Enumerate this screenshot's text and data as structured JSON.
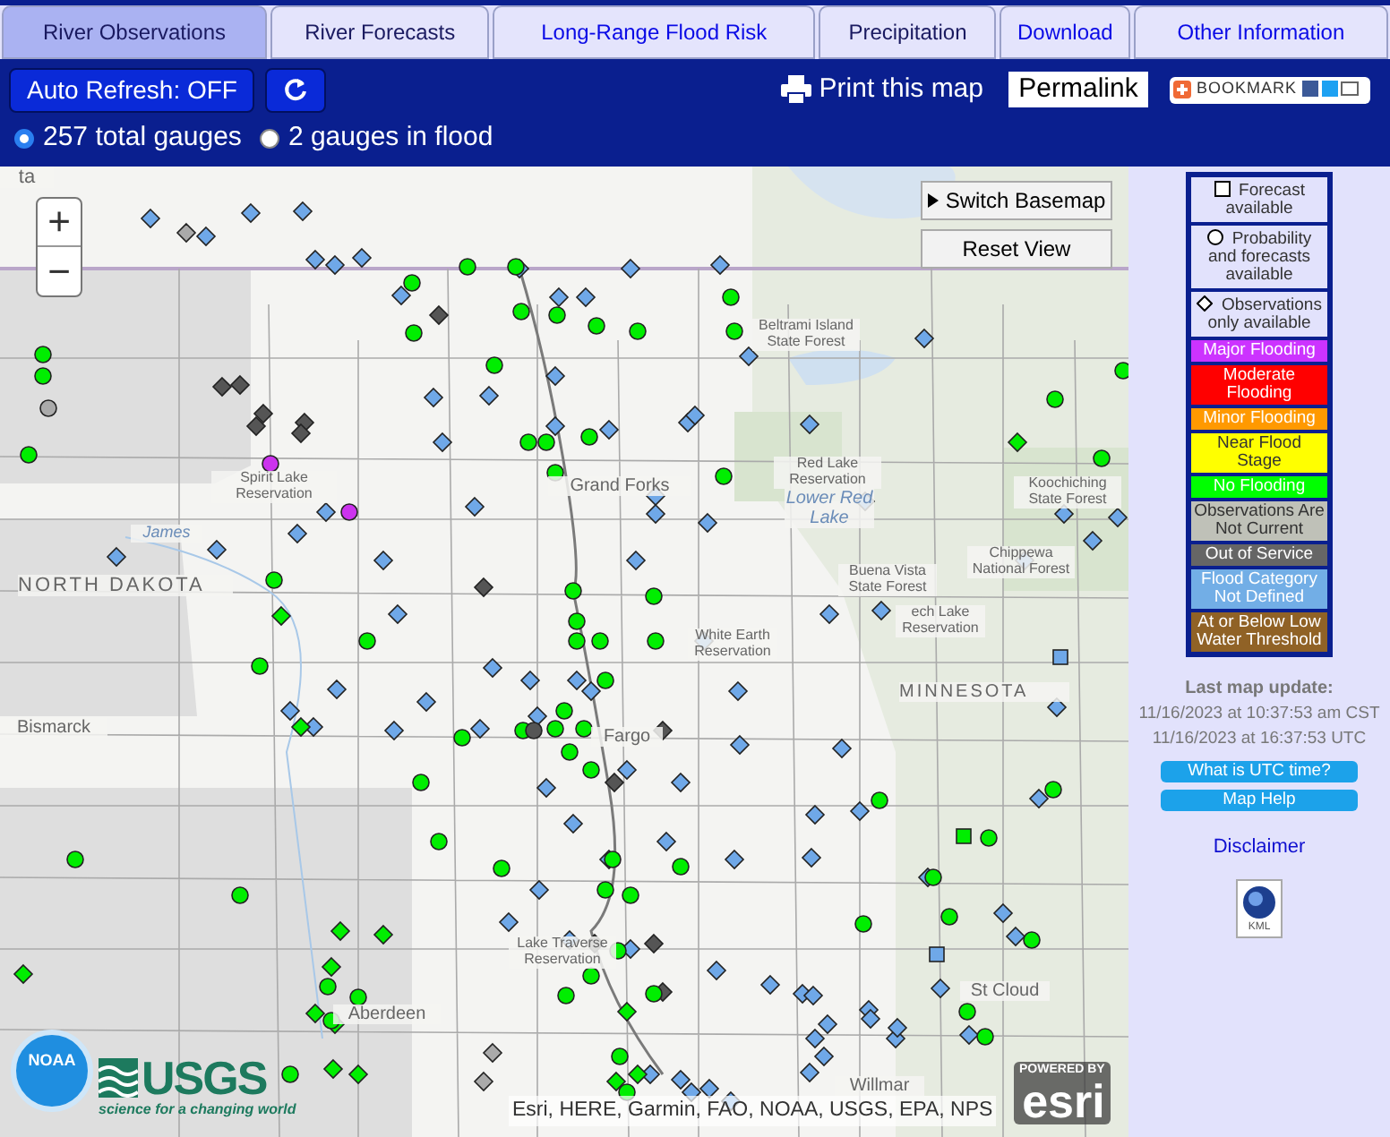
{
  "tabs": [
    {
      "label": "River Observations",
      "selected": true,
      "visited": true
    },
    {
      "label": "River Forecasts",
      "selected": false,
      "visited": true
    },
    {
      "label": "Long-Range Flood Risk",
      "selected": false,
      "visited": false
    },
    {
      "label": "Precipitation",
      "selected": false,
      "visited": true
    },
    {
      "label": "Download",
      "selected": false,
      "visited": false
    },
    {
      "label": "Other Information",
      "selected": false,
      "visited": false
    }
  ],
  "toolbar": {
    "auto_refresh": "Auto Refresh: OFF",
    "print": "Print this map",
    "permalink": "Permalink",
    "bookmark": "BOOKMARK"
  },
  "gauge_filter": [
    {
      "label": "257 total gauges",
      "selected": true
    },
    {
      "label": "2 gauges in flood",
      "selected": false
    }
  ],
  "map": {
    "labels": [
      {
        "text": "ta"
      },
      {
        "text": "Beltrami Island State Forest"
      },
      {
        "text": "Spirit Lake Reservation"
      },
      {
        "text": "Grand Forks"
      },
      {
        "text": "Red Lake Reservation"
      },
      {
        "text": "Lower Red Lake"
      },
      {
        "text": "James"
      },
      {
        "text": "NORTH DAKOTA"
      },
      {
        "text": "Koochiching State Forest"
      },
      {
        "text": "Buena Vista State Forest"
      },
      {
        "text": "Chippewa National Forest"
      },
      {
        "text": "ech Lake Reservation"
      },
      {
        "text": "White Earth Reservation"
      },
      {
        "text": "MINNESOTA"
      },
      {
        "text": "Bismarck"
      },
      {
        "text": "Fargo"
      },
      {
        "text": "Lake Traverse Reservation"
      },
      {
        "text": "Aberdeen"
      },
      {
        "text": "St Cloud"
      },
      {
        "text": "Willmar"
      }
    ],
    "zoom_in": "+",
    "zoom_out": "−",
    "switch_basemap": "Switch Basemap",
    "reset_view": "Reset View",
    "attribution": "Esri, HERE, Garmin, FAO, NOAA, USGS, EPA, NPS",
    "esri_powered": "POWERED BY",
    "esri": "esri",
    "noaa": "NOAA",
    "usgs": "USGS",
    "usgs_tagline": "science for a changing world"
  },
  "legend": [
    {
      "kind": "square",
      "label": "Forecast available"
    },
    {
      "kind": "circle",
      "label": "Probability and forecasts available"
    },
    {
      "kind": "diamond",
      "label": "Observations only available"
    },
    {
      "kind": "category",
      "label": "Major Flooding",
      "color": "#cc33ff"
    },
    {
      "kind": "category",
      "label": "Moderate Flooding",
      "color": "#ff0000"
    },
    {
      "kind": "category",
      "label": "Minor Flooding",
      "color": "#ff9900"
    },
    {
      "kind": "category",
      "label": "Near Flood Stage",
      "color": "#ffff00"
    },
    {
      "kind": "category",
      "label": "No Flooding",
      "color": "#00ff00"
    },
    {
      "kind": "category",
      "label": "Observations Are Not Current",
      "color": "#bfc1b8"
    },
    {
      "kind": "category",
      "label": "Out of Service",
      "color": "#666666"
    },
    {
      "kind": "category",
      "label": "Flood Category Not Defined",
      "color": "#72aee6"
    },
    {
      "kind": "category",
      "label": "At or Below Low Water Threshold",
      "color": "#906226"
    }
  ],
  "update": {
    "title": "Last map update:",
    "local": "11/16/2023 at 10:37:53 am CST",
    "utc": "11/16/2023 at 16:37:53 UTC"
  },
  "buttons": [
    "What is UTC time?",
    "Map Help"
  ],
  "disclaimer": "Disclaimer",
  "kml": "KML"
}
